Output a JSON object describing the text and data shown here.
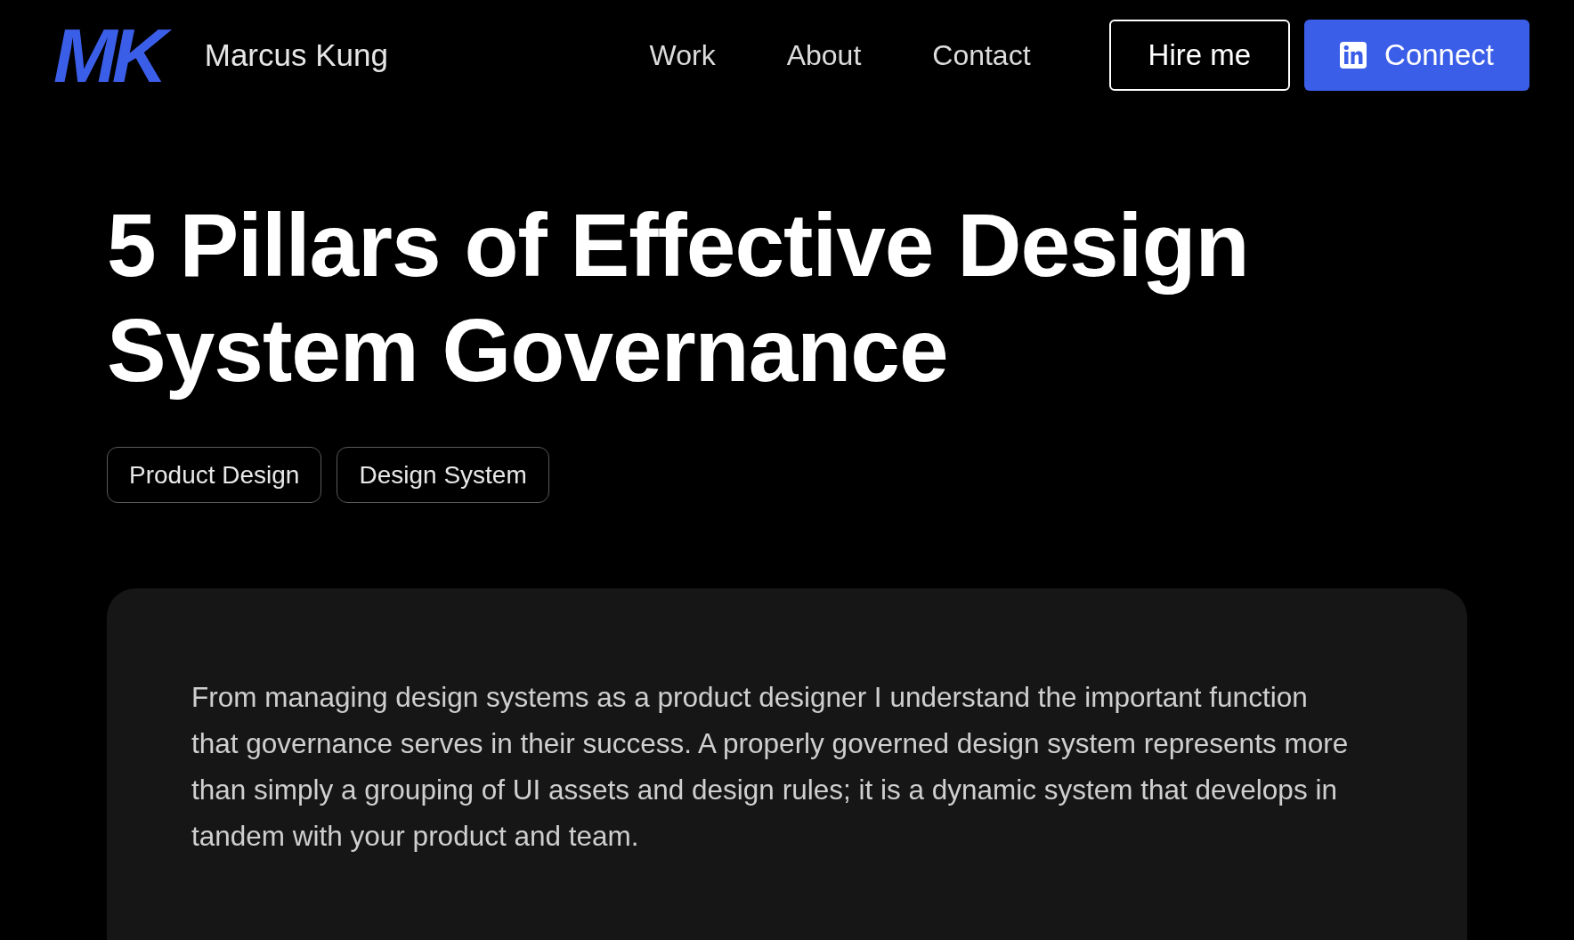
{
  "header": {
    "logo": "MK",
    "name": "Marcus Kung",
    "nav": [
      {
        "label": "Work"
      },
      {
        "label": "About"
      },
      {
        "label": "Contact"
      }
    ],
    "buttons": [
      {
        "label": "Hire me",
        "kind": "outline"
      },
      {
        "label": "Connect",
        "kind": "linkedin"
      }
    ]
  },
  "article": {
    "title": "5 Pillars of Effective Design System Governance",
    "tags": [
      "Product Design",
      "Design System"
    ],
    "intro": "From managing design systems as a product designer I understand the important function that governance serves in their success. A properly governed design system represents more than simply a grouping of UI assets and design rules; it is a dynamic system that develops in tandem with your product and team."
  }
}
